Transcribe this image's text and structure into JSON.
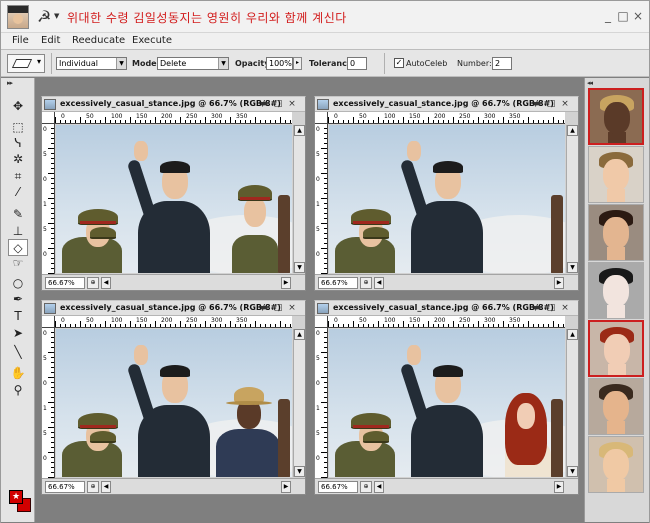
{
  "app": {
    "title": "위대한 수령 김일성동지는 영원히 우리와 함께 계신다",
    "menu": [
      "File",
      "Edit",
      "Reeducate",
      "Execute"
    ],
    "window_controls": {
      "minimize": "_",
      "maximize": "□",
      "close": "×"
    }
  },
  "options": {
    "preset_value": "Individual",
    "mode_label": "Mode:",
    "mode_value": "Delete",
    "opacity_label": "Opacity:",
    "opacity_value": "100%",
    "tolerance_label": "Tolerance:",
    "tolerance_value": "0",
    "autoceleb_label": "AutoCeleb",
    "autoceleb_checked": "✓",
    "number_label": "Number:",
    "number_value": "2"
  },
  "documents": [
    {
      "title": "excessively_casual_stance.jpg @ 66.7% (RGB/8#)",
      "zoom": "66.67%"
    },
    {
      "title": "excessively_casual_stance.jpg @ 66.7% (RGB/8#)",
      "zoom": "66.67%"
    },
    {
      "title": "excessively_casual_stance.jpg @ 66.7% (RGB/8#)",
      "zoom": "66.67%"
    },
    {
      "title": "excessively_casual_stance.jpg @ 66.7% (RGB/8#)",
      "zoom": "66.67%"
    }
  ],
  "ruler": {
    "h_ticks": [
      "0",
      "50",
      "100",
      "150",
      "200",
      "250",
      "300",
      "350"
    ],
    "v_ticks": [
      "0",
      "5",
      "0",
      "1",
      "5",
      "0",
      "1"
    ]
  },
  "doc_controls": {
    "minimize": "▬",
    "maximize": "□",
    "close": "×"
  },
  "tools": [
    {
      "name": "move-tool",
      "glyph": "✥"
    },
    {
      "name": "marquee-tool",
      "glyph": "⬚"
    },
    {
      "name": "lasso-tool",
      "glyph": "ᓭ"
    },
    {
      "name": "magic-wand-tool",
      "glyph": "✲"
    },
    {
      "name": "crop-tool",
      "glyph": "⌗"
    },
    {
      "name": "eyedropper-tool",
      "glyph": "⁄"
    },
    {
      "name": "brush-tool",
      "glyph": "✎"
    },
    {
      "name": "stamp-tool",
      "glyph": "⊥"
    },
    {
      "name": "eraser-tool",
      "glyph": "◇"
    },
    {
      "name": "smudge-tool",
      "glyph": "☞"
    },
    {
      "name": "dodge-tool",
      "glyph": "○"
    },
    {
      "name": "pen-tool",
      "glyph": "✒"
    },
    {
      "name": "type-tool",
      "glyph": "T"
    },
    {
      "name": "selection-tool",
      "glyph": "➤"
    },
    {
      "name": "line-tool",
      "glyph": "╲"
    },
    {
      "name": "hand-tool",
      "glyph": "✋"
    },
    {
      "name": "zoom-tool",
      "glyph": "⚲"
    }
  ],
  "colors": {
    "foreground": "#d10000",
    "background": "#d10000",
    "swatch_glyph": "★"
  },
  "celebrities": [
    {
      "name": "straw-hat-man",
      "selected": true,
      "skin": "#5a3a28",
      "hair": "#c8a460",
      "bg": "#8b6b52"
    },
    {
      "name": "young-singer",
      "selected": false,
      "skin": "#f0c9a8",
      "hair": "#8a6a3c",
      "bg": "#d9d2c8"
    },
    {
      "name": "dark-haired-woman",
      "selected": false,
      "skin": "#e3b590",
      "hair": "#2b1a12",
      "bg": "#9a8c80"
    },
    {
      "name": "pale-pop-star",
      "selected": false,
      "skin": "#f2e4de",
      "hair": "#191919",
      "bg": "#aaa"
    },
    {
      "name": "red-haired-actress",
      "selected": true,
      "skin": "#f1cdb5",
      "hair": "#9b2a16",
      "bg": "#c8b6a8"
    },
    {
      "name": "smiling-actor",
      "selected": false,
      "skin": "#e5b48c",
      "hair": "#3a2a1e",
      "bg": "#b7a99c"
    },
    {
      "name": "blonde-woman",
      "selected": false,
      "skin": "#f0c9a4",
      "hair": "#d8b878",
      "bg": "#d0c0ae"
    }
  ]
}
